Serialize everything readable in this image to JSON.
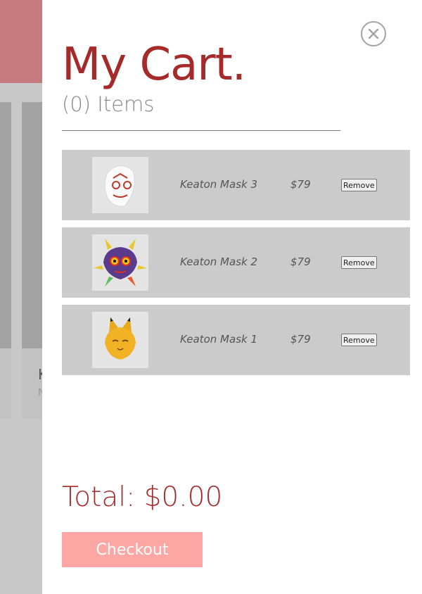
{
  "cart": {
    "title": "My Cart.",
    "item_count": "(0) Items",
    "close_icon": "close-circle-icon",
    "items": [
      {
        "name": "Keaton Mask 3",
        "price": "$79",
        "remove_label": "Remove",
        "image": "white-mask-image"
      },
      {
        "name": "Keaton Mask 2",
        "price": "$79",
        "remove_label": "Remove",
        "image": "majoras-mask-image"
      },
      {
        "name": "Keaton Mask 1",
        "price": "$79",
        "remove_label": "Remove",
        "image": "fox-mask-image"
      }
    ],
    "total": "Total: $0.00",
    "checkout_label": "Checkout"
  },
  "background_page": {
    "card_title": "K",
    "card_sub": "N"
  },
  "colors": {
    "accent": "#a52a2a",
    "checkout": "#fda7a4",
    "item_bg": "#cbcbcb",
    "overlay": "#c8c8c8"
  }
}
